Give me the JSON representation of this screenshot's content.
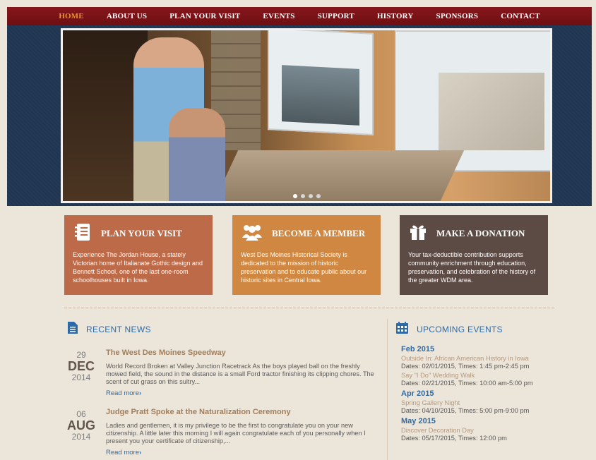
{
  "nav": {
    "items": [
      {
        "label": "HOME",
        "active": true
      },
      {
        "label": "ABOUT US"
      },
      {
        "label": "PLAN YOUR VISIT"
      },
      {
        "label": "EVENTS"
      },
      {
        "label": "SUPPORT"
      },
      {
        "label": "HISTORY"
      },
      {
        "label": "SPONSORS"
      },
      {
        "label": "CONTACT"
      }
    ]
  },
  "hero": {
    "slide_count": 4,
    "active_slide": 1
  },
  "promos": [
    {
      "icon": "notebook-icon",
      "title": "PLAN YOUR VISIT",
      "text": "Experience The Jordan House, a stately Victorian home of Italianate Gothic design and Bennett School, one of the last one-room schoolhouses built in Iowa.",
      "color": "#bd6a49"
    },
    {
      "icon": "group-icon",
      "title": "BECOME A MEMBER",
      "text": "West Des Moines Historical Society is dedicated to the mission of historic preservation and to educate public about our historic sites in Central Iowa.",
      "color": "#d08741"
    },
    {
      "icon": "gift-icon",
      "title": "MAKE A DONATION",
      "text": "Your tax-deductible contribution supports community enrichment through education, preservation, and celebration of the history of the greater WDM area.",
      "color": "#5c4a44"
    }
  ],
  "news": {
    "title": "RECENT NEWS",
    "items": [
      {
        "day": "29",
        "month": "DEC",
        "year": "2014",
        "title": "The West Des Moines Speedway",
        "excerpt": "World Record Broken at Valley Junction Racetrack As the boys played ball on the freshly mowed field, the sound in the distance is a small Ford tractor finishing its clipping chores.  The scent of cut grass on this sultry...",
        "read_more": "Read more"
      },
      {
        "day": "06",
        "month": "AUG",
        "year": "2014",
        "title": "Judge Pratt Spoke at the Naturalization Ceremony",
        "excerpt": "Ladies and gentlemen, it is my privilege to be the first to congratulate you on your new citizenship. A little later this morning I will again congratulate each of you personally when I present you your certificate of citizenship,...",
        "read_more": "Read more"
      }
    ]
  },
  "events": {
    "title": "UPCOMING EVENTS",
    "groups": [
      {
        "month": "Feb 2015",
        "events": [
          {
            "name": "Outside In: African American History in Iowa",
            "dates": "Dates: 02/01/2015, Times: 1:45 pm-2:45 pm"
          },
          {
            "name": "Say \"I Do\" Wedding Walk",
            "dates": "Dates: 02/21/2015, Times: 10:00 am-5:00 pm"
          }
        ]
      },
      {
        "month": "Apr 2015",
        "events": [
          {
            "name": "Spring Gallery Night",
            "dates": "Dates: 04/10/2015, Times: 5:00 pm-9:00 pm"
          }
        ]
      },
      {
        "month": "May 2015",
        "events": [
          {
            "name": "Discover Decoration Day",
            "dates": "Dates: 05/17/2015, Times: 12:00 pm"
          }
        ]
      }
    ]
  },
  "colors": {
    "nav_bg": "#7a1317",
    "nav_active": "#e8932a",
    "link_blue": "#2e6ba6",
    "hero_bg": "#1f3551"
  }
}
